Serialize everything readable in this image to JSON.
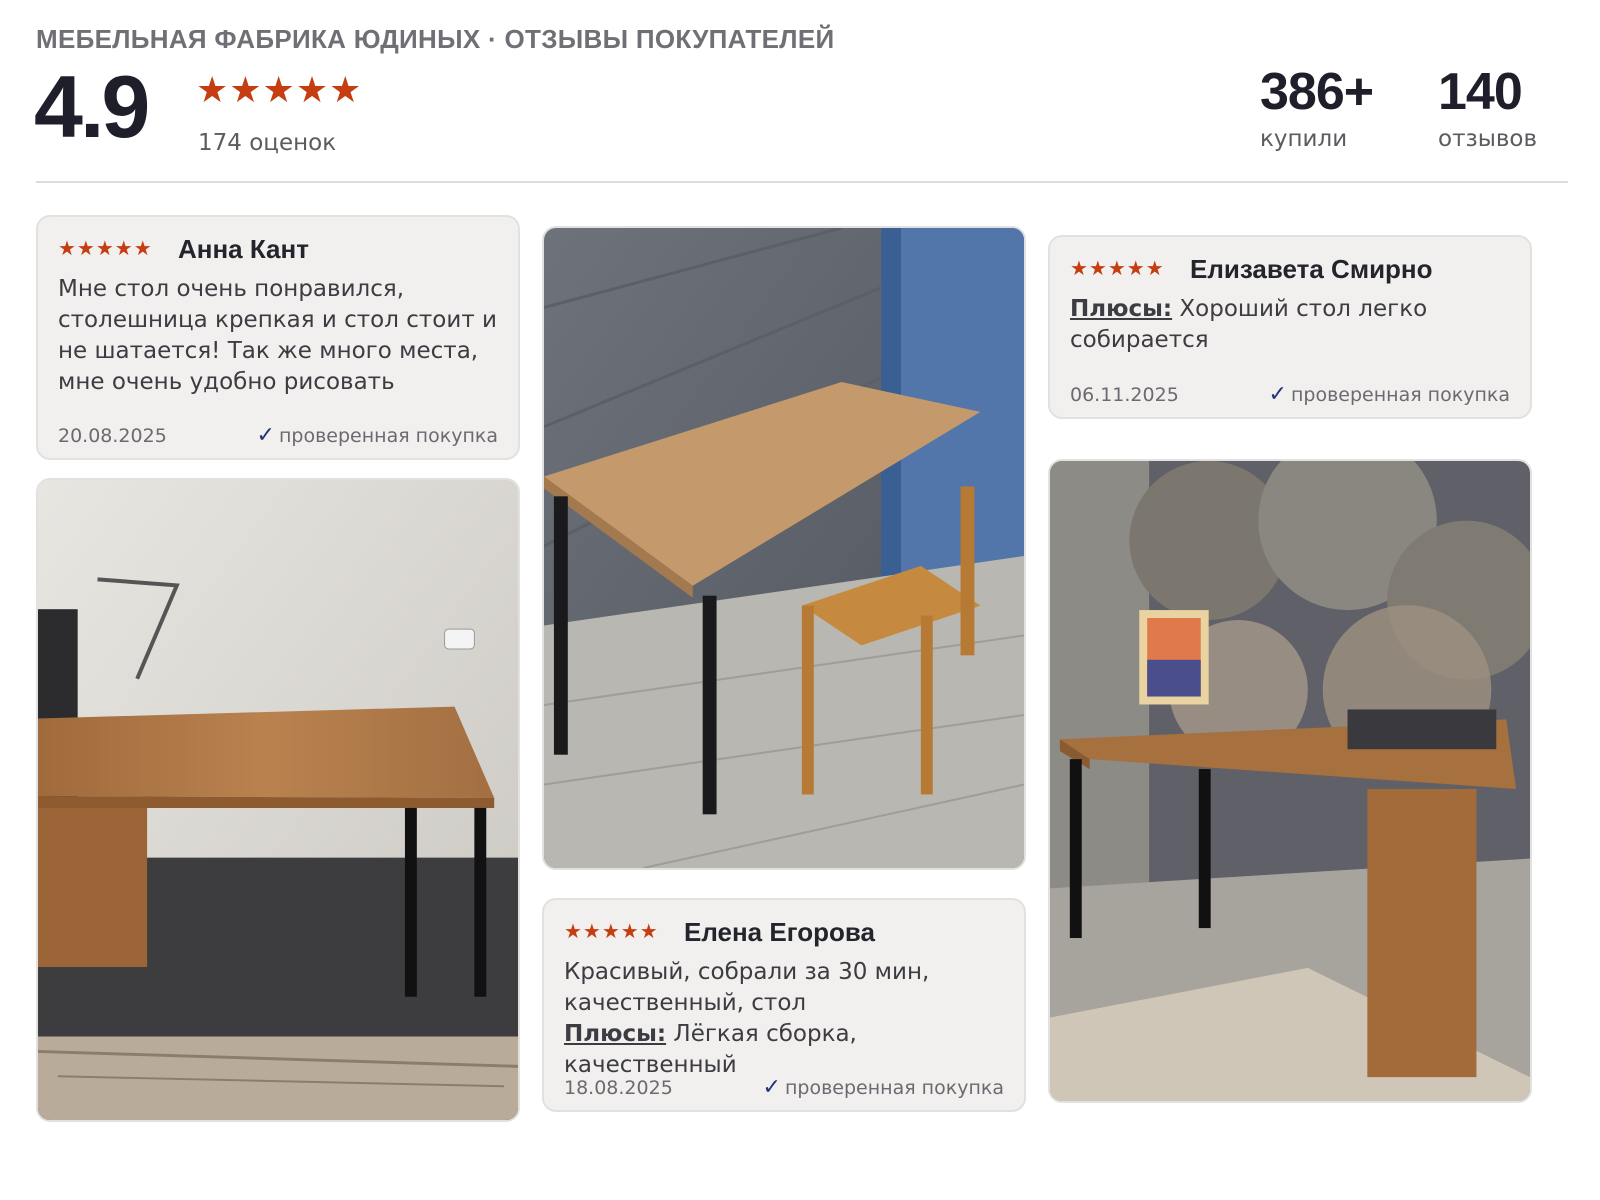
{
  "header": {
    "brand": "МЕБЕЛЬНАЯ ФАБРИКА ЮДИНЫХ · ОТЗЫВЫ ПОКУПАТЕЛЕЙ",
    "rating": "4.9",
    "stars": "★★★★★",
    "ratings_count": "174 оценок",
    "stats": [
      {
        "value": "386+",
        "label": "купили"
      },
      {
        "value": "140",
        "label": "отзывов"
      }
    ]
  },
  "reviews": [
    {
      "stars": "★★★★★",
      "author": "Анна Кант",
      "text": "Мне стол очень понравился, столешница крепкая и стол стоит и не шатается! Так же много места, мне очень удобно рисовать",
      "date": "20.08.2025",
      "verified": "проверенная покупка"
    },
    {
      "stars": "★★★★★",
      "author": "Елена Егорова",
      "text": "Красивый, собрали за 30 мин, качественный, стол",
      "pros_label": "Плюсы:",
      "pros": "Лёгкая сборка, качественный",
      "date": "18.08.2025",
      "verified": "проверенная покупка"
    },
    {
      "stars": "★★★★★",
      "author": "Елизавета Смирно",
      "pros_label": "Плюсы:",
      "pros": "Хороший стол легко собирается",
      "date": "06.11.2025",
      "verified": "проверенная покупка"
    }
  ],
  "check_icon": "✓",
  "colors": {
    "star": "#c53e12",
    "check": "#23357a",
    "card_bg": "#f1f0ee"
  }
}
